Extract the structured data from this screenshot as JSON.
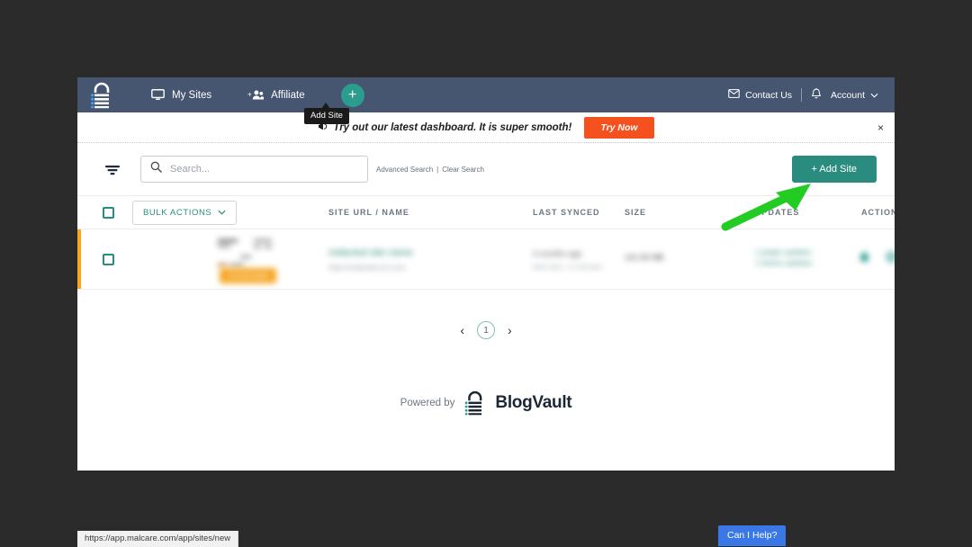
{
  "navbar": {
    "logo_name": "blogvault-lock-logo",
    "links": [
      {
        "label": "My Sites",
        "icon": "monitor-icon"
      },
      {
        "label": "Affiliate",
        "icon": "people-add-icon"
      }
    ],
    "add_button_glyph": "+",
    "add_button_tooltip": "Add Site",
    "contact": "Contact Us",
    "contact_icon": "envelope-icon",
    "bell_icon": "bell-icon",
    "account": "Account",
    "account_caret": "⌄",
    "bg_color": "#465671"
  },
  "promo": {
    "icon": "megaphone-icon",
    "text": "Try out our latest dashboard. It is super smooth!",
    "button": "Try Now",
    "button_color": "#f4511e",
    "close": "×"
  },
  "toolbar": {
    "filter_icon": "filter-funnel-icon",
    "search_placeholder": "Search...",
    "search_value": "",
    "search_icon": "search-icon",
    "advanced_search": "Advanced Search",
    "separator": "|",
    "clear_search": "Clear Search",
    "add_site_label": "+ Add Site",
    "add_site_color": "#2a8c7e"
  },
  "table": {
    "bulk_actions_label": "BULK ACTIONS",
    "bulk_actions_caret": "⌄",
    "columns": [
      "SITE URL / NAME",
      "LAST SYNCED",
      "SIZE",
      "UPDATES",
      "ACTIONS"
    ],
    "rows": [
      {
        "accent_color": "#f5a623",
        "badge": "Unreachable",
        "site_name": "redacted site name",
        "site_url": "http://redacted-url.com",
        "last_synced": "4 months ago",
        "next_sync": "Next Sync : in 18 hours",
        "size": "141.65 MB",
        "updates_line1": "1 plugin updates",
        "updates_line2": "1 theme updates",
        "actions": [
          "sync-icon",
          "settings-icon",
          "remove-icon"
        ]
      }
    ]
  },
  "pagination": {
    "prev": "‹",
    "current_page": "1",
    "next": "›"
  },
  "footer": {
    "powered_by": "Powered by",
    "brand": "BlogVault",
    "logo_name": "blogvault-lock-logo"
  },
  "overlays": {
    "status_url": "https://app.malcare.com/app/sites/new",
    "chat_label": "Can I Help?",
    "chat_color": "#3b78e7",
    "annotation_arrow_color": "#22cc22"
  }
}
